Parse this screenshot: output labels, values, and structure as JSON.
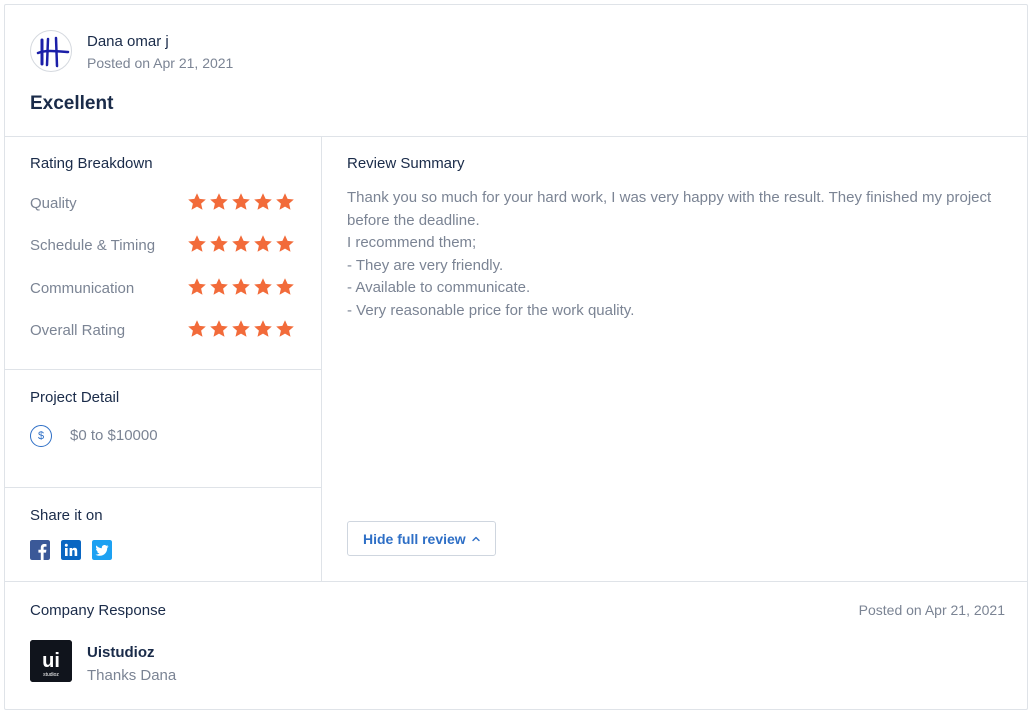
{
  "reviewer": {
    "name": "Dana omar j",
    "posted": "Posted on Apr 21, 2021"
  },
  "review": {
    "title": "Excellent"
  },
  "rating_breakdown": {
    "heading": "Rating Breakdown",
    "items": [
      {
        "label": "Quality",
        "stars": 5
      },
      {
        "label": "Schedule & Timing",
        "stars": 5
      },
      {
        "label": "Communication",
        "stars": 5
      },
      {
        "label": "Overall Rating",
        "stars": 5
      }
    ],
    "max_stars": 5,
    "star_color": "#f26b3a"
  },
  "project_detail": {
    "heading": "Project Detail",
    "icon": "dollar-circle-icon",
    "dollar_glyph": "$",
    "budget": "$0 to $10000"
  },
  "share": {
    "heading": "Share it on",
    "networks": [
      "facebook-icon",
      "linkedin-icon",
      "twitter-icon"
    ]
  },
  "summary": {
    "heading": "Review Summary",
    "lines": [
      "Thank you so much for your hard work, I was very happy with the result. They finished my project before the deadline.",
      "I recommend them;",
      "- They are very friendly.",
      "- Available to communicate.",
      "- Very reasonable price for the work quality."
    ],
    "toggle_label": "Hide full review"
  },
  "company_response": {
    "heading": "Company Response",
    "posted": "Posted on Apr 21, 2021",
    "company_name": "Uistudioz",
    "logo_text": "ui",
    "logo_subtext": "studioz",
    "reply": "Thanks Dana"
  },
  "colors": {
    "accent": "#2e6fc6",
    "heading": "#1a2b49",
    "muted": "#7b8494",
    "border": "#dfe3e8",
    "facebook": "#3b5998",
    "linkedin": "#0a66c2",
    "twitter": "#1da1f2"
  }
}
